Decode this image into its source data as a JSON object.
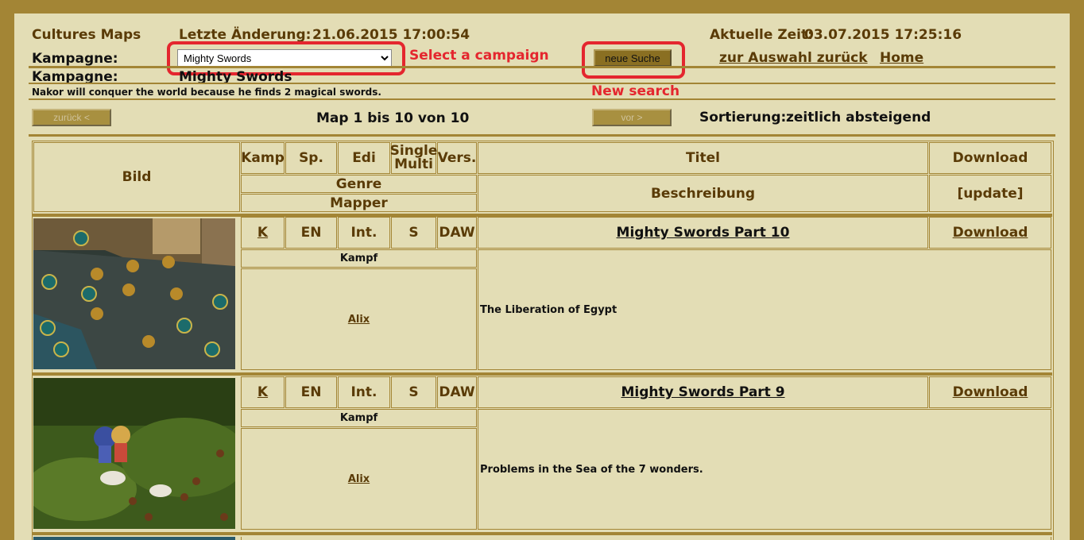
{
  "header": {
    "site_title": "Cultures Maps",
    "last_change_label": "Letzte Änderung:",
    "last_change_value": "21.06.2015 17:00:54",
    "current_time_label": "Aktuelle Zeit:",
    "current_time_value": "03.07.2015 17:25:16"
  },
  "campaign_select": {
    "label": "Kampagne:",
    "selected": "Mighty Swords",
    "annotation": "Select a campaign"
  },
  "search": {
    "button_label": "neue Suche",
    "annotation": "New search"
  },
  "nav": {
    "back_link": "zur Auswahl zurück",
    "home_link": "Home"
  },
  "campaign_info": {
    "label": "Kampagne:",
    "name": "Mighty Swords",
    "description": "Nakor will conquer the world because he finds 2 magical swords."
  },
  "paging": {
    "prev_label": "zurück <",
    "range_text": "Map 1 bis 10 von 10",
    "next_label": "vor >",
    "sort_label": "Sortierung:",
    "sort_value": "zeitlich absteigend"
  },
  "table": {
    "headers": {
      "image": "Bild",
      "kamp": "Kamp",
      "players": "Sp.",
      "edition": "Edi",
      "mode_single": "Single",
      "mode_multi": "Multi",
      "version": "Vers.",
      "title": "Titel",
      "download": "Download",
      "genre": "Genre",
      "mapper": "Mapper",
      "description": "Beschreibung",
      "update": "[update]"
    },
    "rows": [
      {
        "kamp": "K",
        "players": "EN",
        "edition": "Int.",
        "mode": "S",
        "version": "DAW",
        "title": "Mighty Swords Part 10",
        "download": "Download",
        "genre": "Kampf",
        "mapper": "Alix",
        "description": "The Liberation of Egypt",
        "thumbnail_icon": "desert-battle-thumbnail"
      },
      {
        "kamp": "K",
        "players": "EN",
        "edition": "Int.",
        "mode": "S",
        "version": "DAW",
        "title": "Mighty Swords Part 9",
        "download": "Download",
        "genre": "Kampf",
        "mapper": "Alix",
        "description": "Problems in the Sea of the 7 wonders.",
        "thumbnail_icon": "meadow-sheep-thumbnail"
      }
    ]
  },
  "colors": {
    "frame": "#a38535",
    "background": "#e3ddb5",
    "text": "#5a3b07",
    "annotation": "#e4262e"
  }
}
